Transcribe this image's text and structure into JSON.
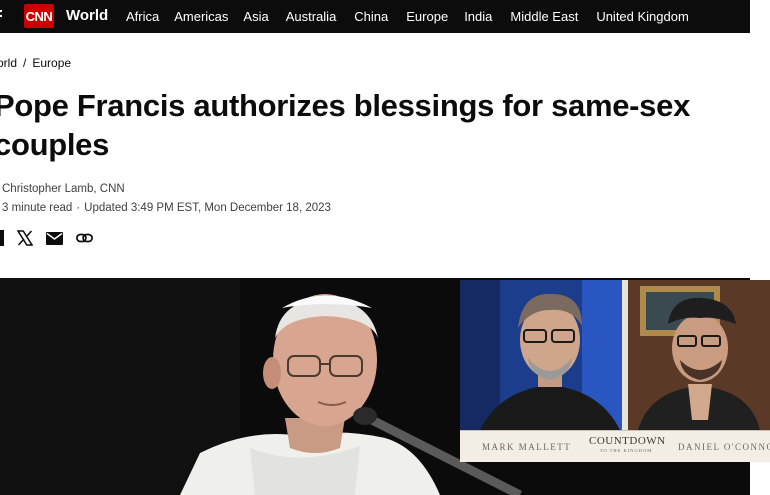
{
  "nav": {
    "logo": "CNN",
    "section": "World",
    "links": [
      "Africa",
      "Americas",
      "Asia",
      "Australia",
      "China",
      "Europe",
      "India",
      "Middle East",
      "United Kingdom"
    ]
  },
  "breadcrumb": {
    "items": [
      "orld",
      "Europe"
    ],
    "separator": "/"
  },
  "article": {
    "headline": "Pope Francis authorizes blessings for same-sex couples",
    "byline": "Christopher Lamb, CNN",
    "read_time": "3 minute read",
    "updated": "Updated 3:49 PM EST, Mon December 18, 2023"
  },
  "share_icons": [
    "facebook-icon",
    "x-icon",
    "email-icon",
    "link-icon"
  ],
  "video_overlay": {
    "left_name": "MARK MALLETT",
    "right_name": "DANIEL O'CONNO",
    "show_title": "COUNTDOWN",
    "show_subtitle": "TO THE KINGDOM"
  },
  "colors": {
    "nav_bg": "#0c0c0c",
    "brand_red": "#cc0000",
    "text": "#0c0c0c",
    "meta": "#404040"
  }
}
